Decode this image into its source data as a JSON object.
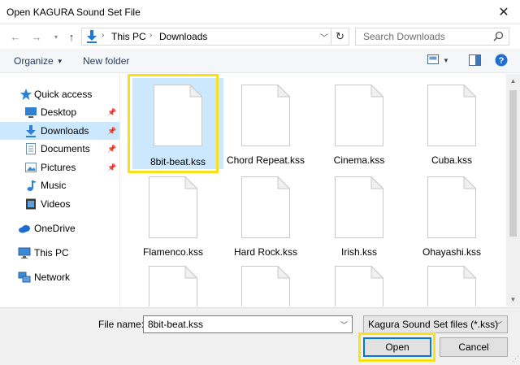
{
  "window": {
    "title": "Open KAGURA Sound Set File",
    "close_glyph": "✕"
  },
  "address": {
    "crumbs": [
      "This PC",
      "Downloads"
    ],
    "search_placeholder": "Search Downloads"
  },
  "toolbar": {
    "organize": "Organize",
    "new_folder": "New folder",
    "help": "?"
  },
  "sidebar": {
    "items": [
      {
        "label": "Quick access",
        "icon": "star-icon"
      },
      {
        "label": "Desktop",
        "icon": "desktop-icon",
        "pinned": true
      },
      {
        "label": "Downloads",
        "icon": "download-icon",
        "pinned": true,
        "selected": true
      },
      {
        "label": "Documents",
        "icon": "documents-icon",
        "pinned": true
      },
      {
        "label": "Pictures",
        "icon": "pictures-icon",
        "pinned": true
      },
      {
        "label": "Music",
        "icon": "music-icon"
      },
      {
        "label": "Videos",
        "icon": "videos-icon"
      },
      {
        "label": "OneDrive",
        "icon": "cloud-icon"
      },
      {
        "label": "This PC",
        "icon": "computer-icon"
      },
      {
        "label": "Network",
        "icon": "network-icon"
      }
    ]
  },
  "files": [
    {
      "name": "8bit-beat.kss",
      "selected": true
    },
    {
      "name": "Chord Repeat.kss"
    },
    {
      "name": "Cinema.kss"
    },
    {
      "name": "Cuba.kss"
    },
    {
      "name": "Flamenco.kss"
    },
    {
      "name": "Hard Rock.kss"
    },
    {
      "name": "Irish.kss"
    },
    {
      "name": "Ohayashi.kss"
    },
    {
      "name": ""
    },
    {
      "name": ""
    },
    {
      "name": ""
    },
    {
      "name": ""
    }
  ],
  "footer": {
    "file_name_label": "File name:",
    "file_name_value": "8bit-beat.kss",
    "filter_value": "Kagura Sound Set files (*.kss)",
    "open_label": "Open",
    "cancel_label": "Cancel"
  },
  "colors": {
    "highlight": "#f5e21a",
    "selection": "#cce8ff",
    "accent": "#0078d7"
  }
}
